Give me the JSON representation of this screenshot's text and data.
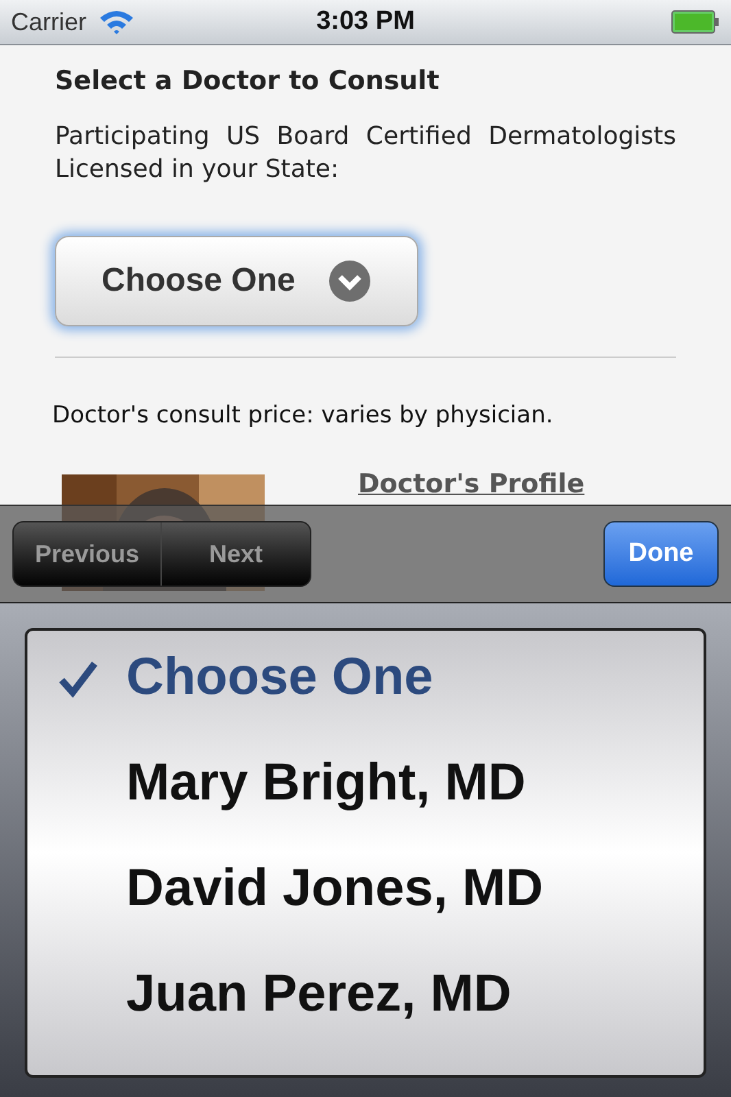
{
  "status_bar": {
    "carrier": "Carrier",
    "time": "3:03 PM"
  },
  "heading": "Select a Doctor to Consult",
  "intro": "Participating US Board Certified Dermatologists Licensed in your State:",
  "select": {
    "value": "Choose One"
  },
  "price_note": "Doctor's consult price: varies by physician.",
  "profile": {
    "link": "Doctor's Profile"
  },
  "toolbar": {
    "buttons": [
      {
        "label": "Previous",
        "disabled": true
      },
      {
        "label": "Next",
        "disabled": true
      }
    ],
    "done": "Done"
  },
  "picker": {
    "options": [
      {
        "label": "Choose One",
        "selected": true
      },
      {
        "label": "Mary Bright, MD",
        "selected": false
      },
      {
        "label": "David Jones, MD",
        "selected": false
      },
      {
        "label": "Juan Perez, MD",
        "selected": false
      }
    ]
  }
}
